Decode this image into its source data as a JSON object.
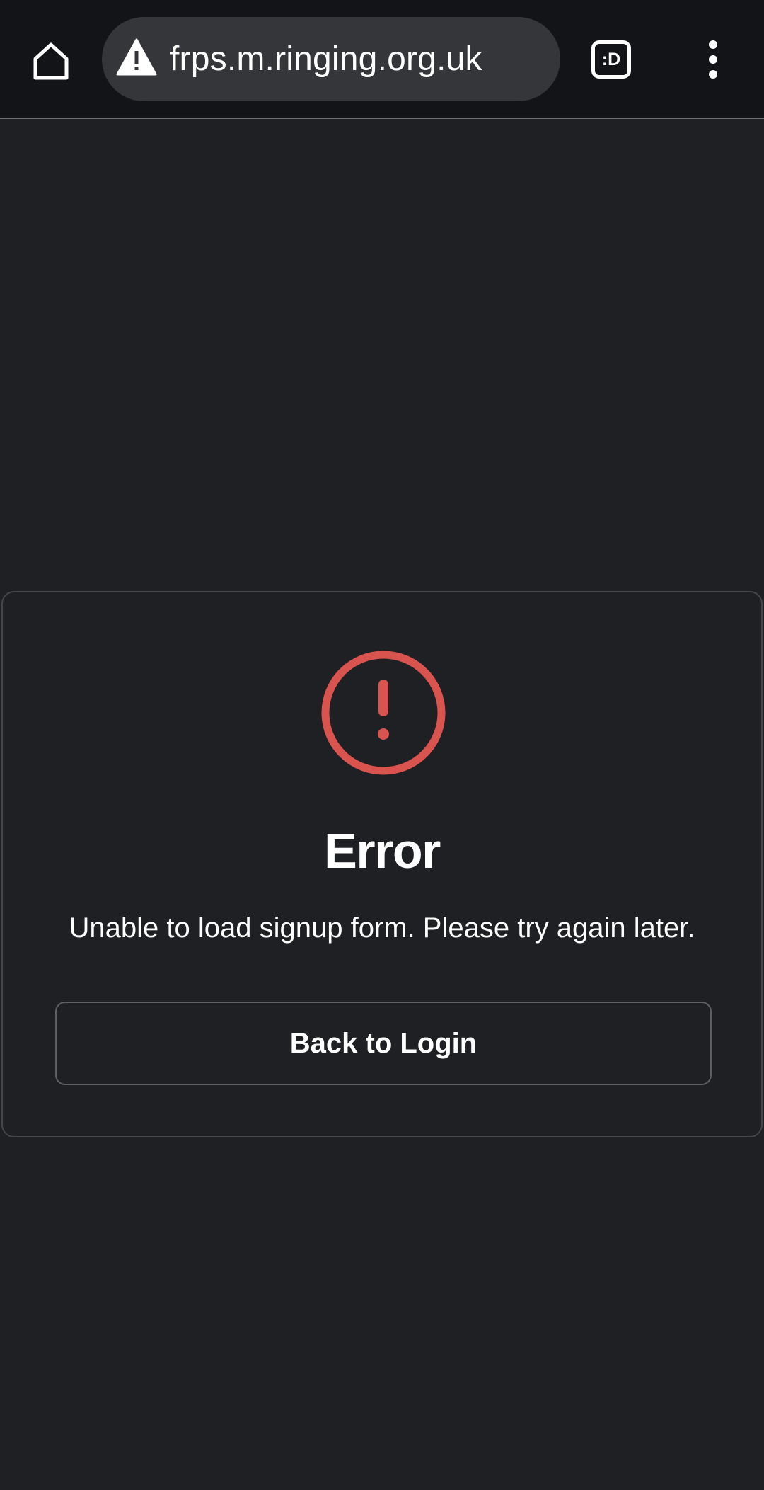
{
  "browser": {
    "url": "frps.m.ringing.org.uk",
    "tab_switcher_label": ":D",
    "icons": {
      "home": "home-icon",
      "security": "warning-icon",
      "tabs": "tab-switcher-icon",
      "menu": "more-vert-icon"
    }
  },
  "error_card": {
    "icon": "exclamation-circle-icon",
    "title": "Error",
    "message": "Unable to load signup form. Please try again later.",
    "back_button_label": "Back to Login"
  },
  "colors": {
    "page_background": "#1f2023",
    "toolbar_background": "#131418",
    "omnibox_background": "#35363a",
    "error_red": "#d9534f",
    "text": "#ffffff",
    "border": "#45464a"
  }
}
